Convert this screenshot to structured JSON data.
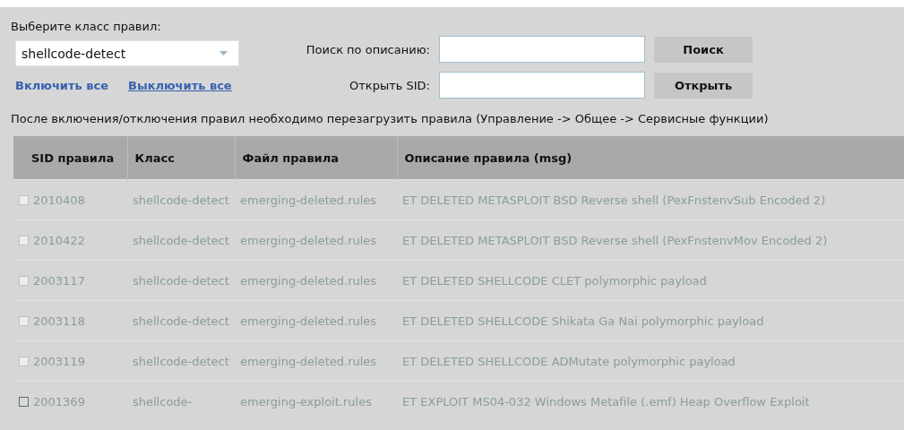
{
  "class_select": {
    "label": "Выберите класс правил:",
    "value": "shellcode-detect"
  },
  "links": [
    {
      "label": "Включить все",
      "underlined": false
    },
    {
      "label": "Выключить все",
      "underlined": true
    }
  ],
  "search": {
    "label": "Поиск по описанию:",
    "button": "Поиск"
  },
  "open_sid": {
    "label": "Открыть SID:",
    "button": "Открыть"
  },
  "notice": "После включения/отключения правил необходимо перезагрузить правила (Управление -> Общее -> Сервисные функции)",
  "table": {
    "columns": [
      "SID правила",
      "Класс",
      "Файл правила",
      "Описание правила (msg)"
    ],
    "rows": [
      {
        "sid": "2010408",
        "class": "shellcode-detect",
        "file": "emerging-deleted.rules",
        "msg": "ET DELETED METASPLOIT BSD Reverse shell (PexFnstenvSub Encoded 2)",
        "checked": false,
        "disabled": true
      },
      {
        "sid": "2010422",
        "class": "shellcode-detect",
        "file": "emerging-deleted.rules",
        "msg": "ET DELETED METASPLOIT BSD Reverse shell (PexFnstenvMov Encoded 2)",
        "checked": false,
        "disabled": true
      },
      {
        "sid": "2003117",
        "class": "shellcode-detect",
        "file": "emerging-deleted.rules",
        "msg": "ET DELETED SHELLCODE CLET polymorphic payload",
        "checked": false,
        "disabled": true
      },
      {
        "sid": "2003118",
        "class": "shellcode-detect",
        "file": "emerging-deleted.rules",
        "msg": "ET DELETED SHELLCODE Shikata Ga Nai polymorphic payload",
        "checked": false,
        "disabled": true
      },
      {
        "sid": "2003119",
        "class": "shellcode-detect",
        "file": "emerging-deleted.rules",
        "msg": "ET DELETED SHELLCODE ADMutate polymorphic payload",
        "checked": false,
        "disabled": true
      },
      {
        "sid": "2001369",
        "class": "shellcode-",
        "file": "emerging-exploit.rules",
        "msg": "ET EXPLOIT MS04-032 Windows Metafile (.emf) Heap Overflow Exploit",
        "checked": false,
        "disabled": false
      }
    ]
  }
}
